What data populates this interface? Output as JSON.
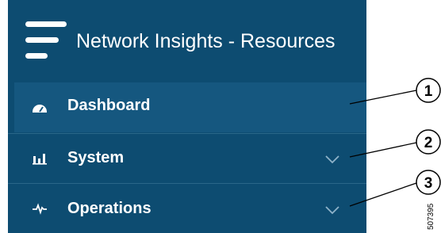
{
  "header": {
    "menu_icon": "hamburger-menu-icon",
    "title": "Network Insights - Resources"
  },
  "nav": {
    "items": [
      {
        "label": "Dashboard",
        "icon": "dashboard-gauge-icon",
        "selected": true,
        "expandable": false
      },
      {
        "label": "System",
        "icon": "bar-chart-icon",
        "selected": false,
        "expandable": true,
        "chevron_icon": "chevron-down-icon"
      },
      {
        "label": "Operations",
        "icon": "pulse-icon",
        "selected": false,
        "expandable": true,
        "chevron_icon": "chevron-down-icon"
      }
    ]
  },
  "callouts": [
    "1",
    "2",
    "3"
  ],
  "figure_id": "507395",
  "colors": {
    "sidebar_bg": "#0d4c71",
    "selected_item_bg": "#15577f",
    "divider": "#2a6789",
    "text": "#ffffff",
    "chevron": "#8fb3c9"
  }
}
